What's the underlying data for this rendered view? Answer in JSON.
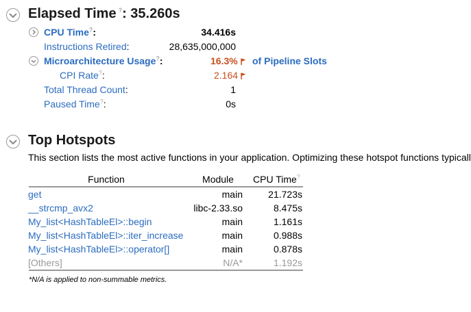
{
  "summary": {
    "help_mark": "?",
    "elapsed": {
      "label": "Elapsed Time",
      "sep": ": ",
      "value": "35.260s"
    },
    "metrics": {
      "cpu_time": {
        "label": "CPU Time",
        "value": "34.416s"
      },
      "instructions_retired": {
        "label": "Instructions Retired",
        "value": "28,635,000,000"
      },
      "microarch_usage": {
        "label": "Microarchitecture Usage",
        "value": "16.3%",
        "suffix": "of Pipeline Slots"
      },
      "cpi_rate": {
        "label": "CPI Rate",
        "value": "2.164"
      },
      "total_thread_count": {
        "label": "Total Thread Count",
        "value": "1"
      },
      "paused_time": {
        "label": "Paused Time",
        "value": "0s"
      }
    },
    "colon": ":"
  },
  "hotspots": {
    "title": "Top Hotspots",
    "description": "This section lists the most active functions in your application. Optimizing these hotspot functions typicall",
    "columns": {
      "function": "Function",
      "module": "Module",
      "cpu_time": "CPU Time"
    },
    "rows": [
      {
        "function": "get",
        "module": "main",
        "cpu_time": "21.723s"
      },
      {
        "function": "__strcmp_avx2",
        "module": "libc-2.33.so",
        "cpu_time": "8.475s"
      },
      {
        "function": "My_list<HashTableEl>::begin",
        "module": "main",
        "cpu_time": "1.161s"
      },
      {
        "function": "My_list<HashTableEl>::iter_increase",
        "module": "main",
        "cpu_time": "0.988s"
      },
      {
        "function": "My_list<HashTableEl>::operator[]",
        "module": "main",
        "cpu_time": "0.878s"
      },
      {
        "function": "[Others]",
        "module": "N/A*",
        "cpu_time": "1.192s"
      }
    ],
    "footnote": "*N/A is applied to non-summable metrics."
  },
  "colors": {
    "link": "#2b6cbf",
    "warning": "#c8501e",
    "dimmed": "#999999"
  },
  "icons": {
    "collapse": "chevron-down-icon",
    "expand": "chevron-right-icon",
    "issue_flag": "flag-icon",
    "help": "help-icon"
  }
}
